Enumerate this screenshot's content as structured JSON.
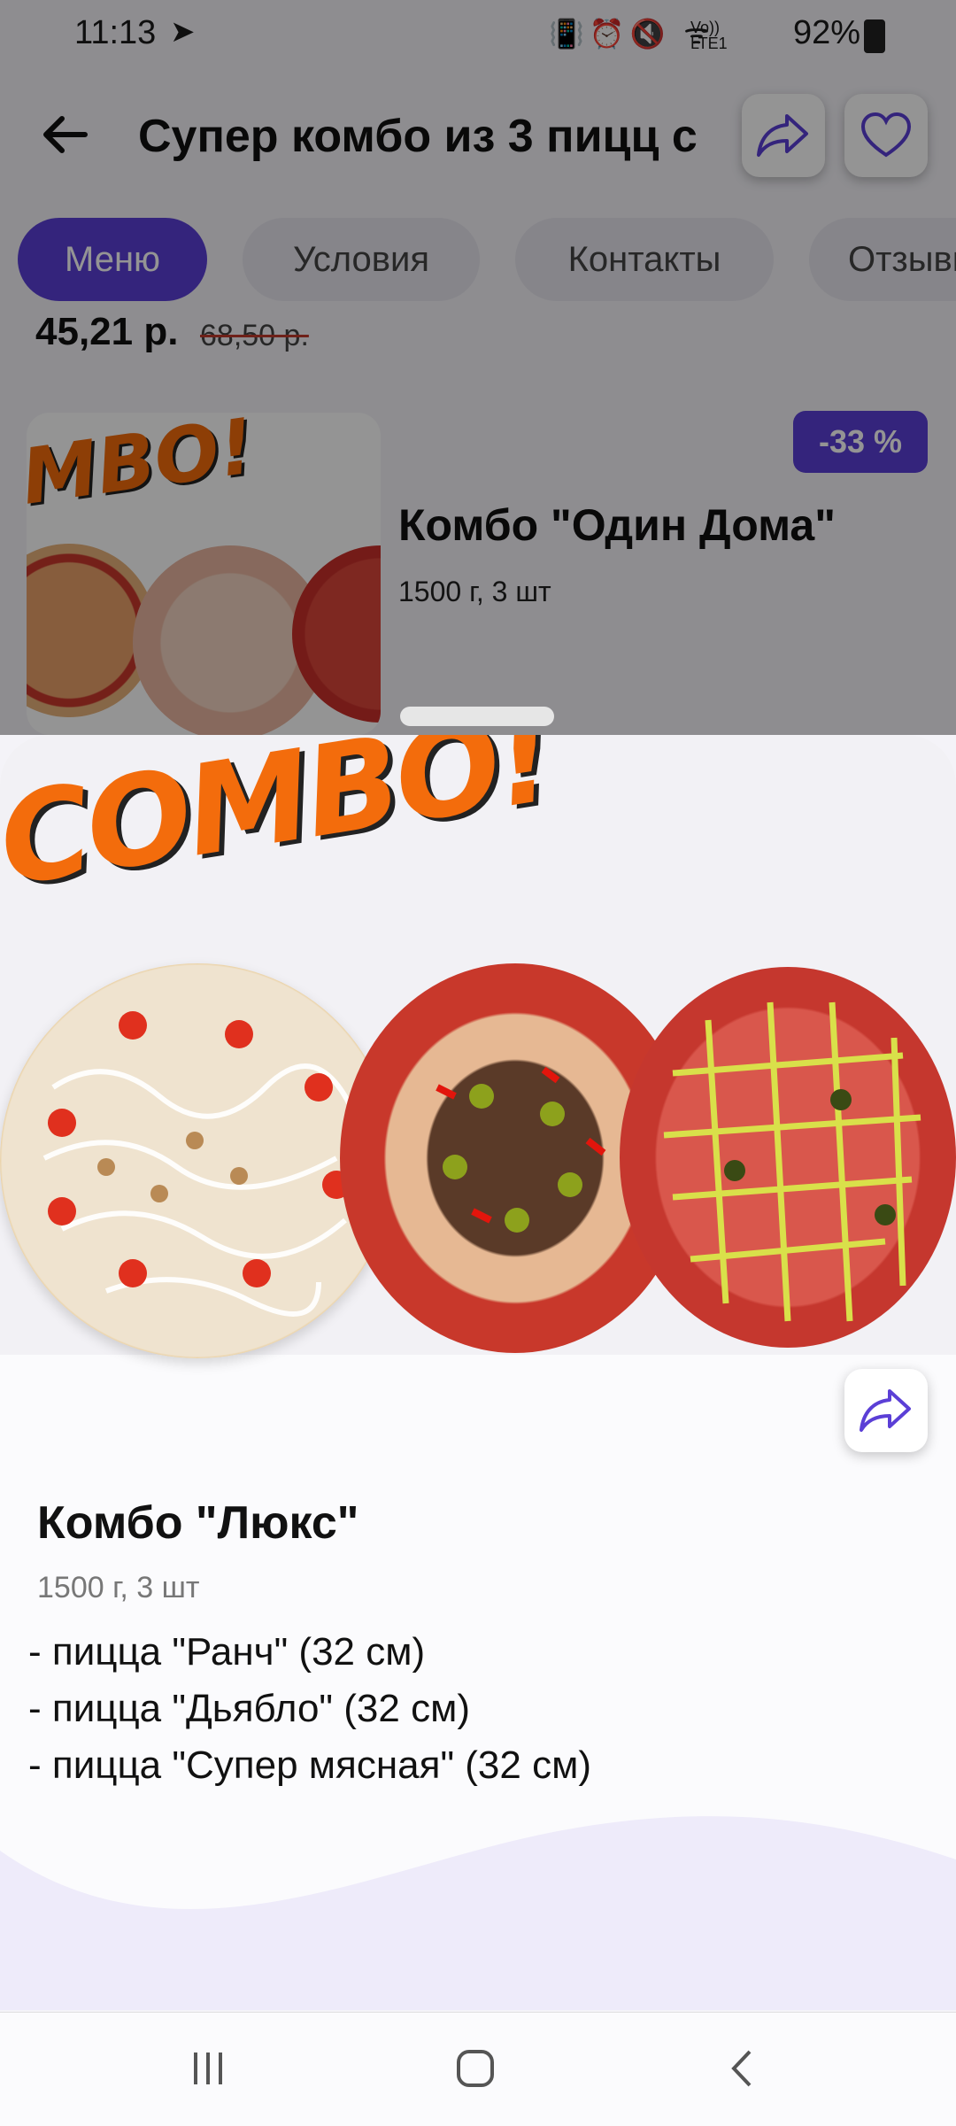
{
  "status_bar": {
    "time": "11:13",
    "icons_text": "📳⏰🔇 ᯤ",
    "lte_label": "Vo)) LTE1",
    "battery": "92%"
  },
  "header": {
    "title": "Супер комбо из 3 пицц с",
    "back_icon": "arrow-left-icon",
    "share_icon": "share-icon",
    "favorite_icon": "heart-icon"
  },
  "tabs": [
    {
      "label": "Меню",
      "active": true
    },
    {
      "label": "Условия",
      "active": false
    },
    {
      "label": "Контакты",
      "active": false
    },
    {
      "label": "Отзывы",
      "active": false
    }
  ],
  "previous_item": {
    "price": "45,21 р.",
    "old_price": "68,50 р."
  },
  "list_item": {
    "discount": "-33 %",
    "title": "Комбо \"Один Дома\"",
    "subtitle": "1500 г, 3 шт",
    "image_text": "MBO!"
  },
  "product": {
    "image_text": "COMBO!",
    "title": "Комбо \"Люкс\"",
    "weight": "1500 г, 3 шт",
    "description": [
      "- пицца \"Ранч\" (32 см)",
      "- пицца \"Дьябло\" (32 см)",
      "- пицца \"Супер мясная\" (32 см)"
    ]
  },
  "colors": {
    "accent": "#5b3fd6",
    "combo_orange": "#f36c0c"
  }
}
